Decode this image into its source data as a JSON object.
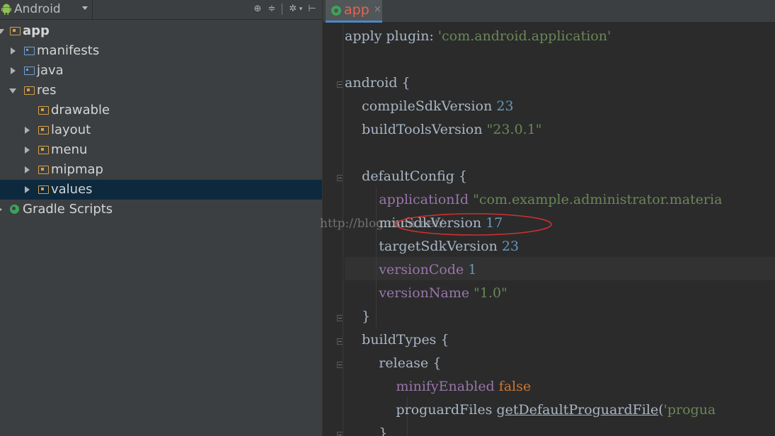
{
  "toolbar": {
    "view_label": "Android",
    "tools": [
      "sync-icon",
      "collapse-icon",
      "gear-icon",
      "pin-icon"
    ]
  },
  "tree": {
    "items": [
      {
        "label": "app",
        "icon": "module-folder-icon",
        "state": "expanded"
      },
      {
        "label": "manifests",
        "icon": "folder-icon",
        "state": "collapsed"
      },
      {
        "label": "java",
        "icon": "folder-icon",
        "state": "collapsed"
      },
      {
        "label": "res",
        "icon": "resource-folder-icon",
        "state": "expanded"
      },
      {
        "label": "drawable",
        "icon": "resource-folder-icon",
        "state": "leaf"
      },
      {
        "label": "layout",
        "icon": "resource-folder-icon",
        "state": "collapsed"
      },
      {
        "label": "menu",
        "icon": "resource-folder-icon",
        "state": "collapsed"
      },
      {
        "label": "mipmap",
        "icon": "resource-folder-icon",
        "state": "collapsed"
      },
      {
        "label": "values",
        "icon": "resource-folder-icon",
        "state": "collapsed",
        "selected": true
      },
      {
        "label": "Gradle Scripts",
        "icon": "gradle-icon",
        "state": "collapsed"
      }
    ]
  },
  "editor": {
    "tab": {
      "label": "app",
      "close": "×"
    },
    "lines": [
      [
        {
          "t": "apply plugin: ",
          "c": "plain"
        },
        {
          "t": "'com.android.application'",
          "c": "string"
        }
      ],
      [],
      [
        {
          "t": "android {",
          "c": "plain"
        }
      ],
      [
        {
          "t": "    compileSdkVersion ",
          "c": "plain"
        },
        {
          "t": "23",
          "c": "number"
        }
      ],
      [
        {
          "t": "    buildToolsVersion ",
          "c": "plain"
        },
        {
          "t": "\"23.0.1\"",
          "c": "string"
        }
      ],
      [],
      [
        {
          "t": "    defaultConfig {",
          "c": "plain"
        }
      ],
      [
        {
          "t": "        ",
          "c": "plain"
        },
        {
          "t": "applicationId ",
          "c": "property"
        },
        {
          "t": "\"com.example.administrator.materia",
          "c": "string"
        }
      ],
      [
        {
          "t": "        minSdkVersion ",
          "c": "plain"
        },
        {
          "t": "17",
          "c": "number"
        }
      ],
      [
        {
          "t": "        targetSdkVersion ",
          "c": "plain"
        },
        {
          "t": "23",
          "c": "number"
        }
      ],
      [
        {
          "t": "        ",
          "c": "plain"
        },
        {
          "t": "versionCode ",
          "c": "property"
        },
        {
          "t": "1",
          "c": "number"
        }
      ],
      [
        {
          "t": "        ",
          "c": "plain"
        },
        {
          "t": "versionName ",
          "c": "property"
        },
        {
          "t": "\"1.0\"",
          "c": "string"
        }
      ],
      [
        {
          "t": "    }",
          "c": "plain"
        }
      ],
      [
        {
          "t": "    buildTypes {",
          "c": "plain"
        }
      ],
      [
        {
          "t": "        release {",
          "c": "plain"
        }
      ],
      [
        {
          "t": "            ",
          "c": "plain"
        },
        {
          "t": "minifyEnabled ",
          "c": "property"
        },
        {
          "t": "false",
          "c": "keyword"
        }
      ],
      [
        {
          "t": "            proguardFiles ",
          "c": "plain"
        },
        {
          "t": "getDefaultProguardFile",
          "c": "method"
        },
        {
          "t": "(",
          "c": "plain"
        },
        {
          "t": "'progua",
          "c": "string"
        }
      ],
      [
        {
          "t": "        }",
          "c": "plain"
        }
      ]
    ]
  },
  "watermark": "http://blog.csdn.net/",
  "colors": {
    "panel_bg": "#3c3f41",
    "editor_bg": "#2b2b2b",
    "selection": "#0d293e",
    "string": "#6a8759",
    "number": "#6897bb",
    "property": "#9876aa",
    "keyword": "#cc7832",
    "annotation_ellipse": "#d03030"
  }
}
